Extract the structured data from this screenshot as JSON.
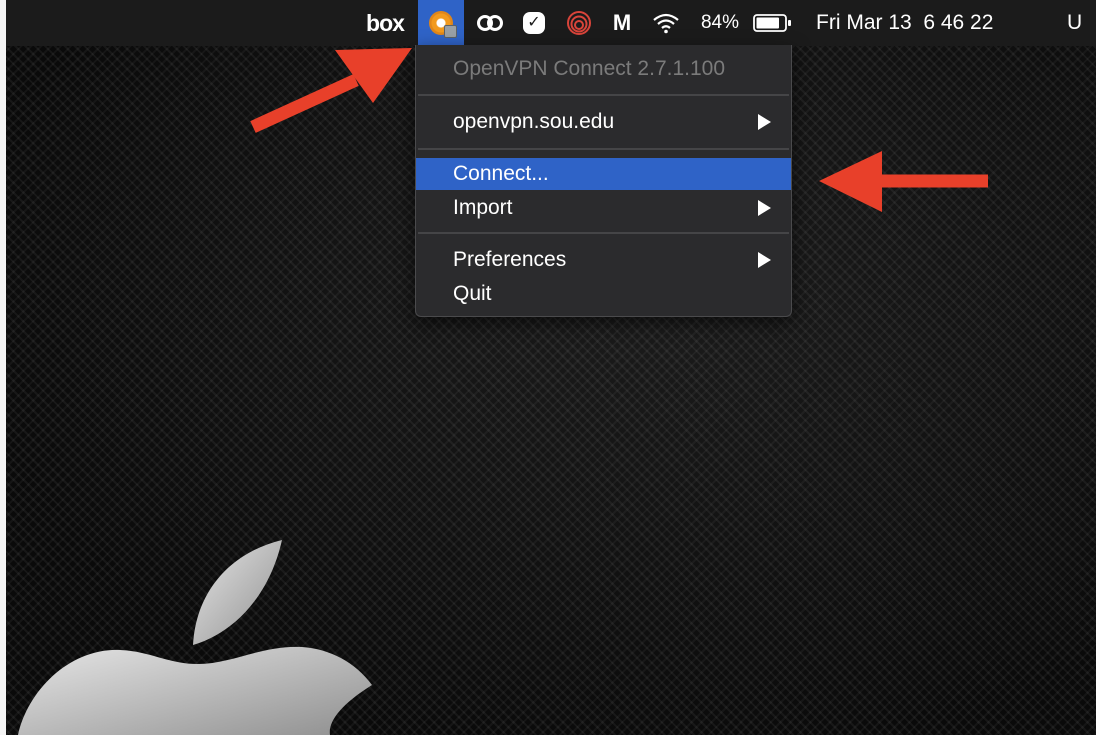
{
  "menubar": {
    "box_label": "box",
    "icons": [
      "openvpn-icon",
      "creative-cloud-icon",
      "check-shield-icon",
      "rings-icon",
      "malwarebytes-icon",
      "wifi-icon",
      "battery-icon"
    ],
    "active_icon": "openvpn-icon",
    "m_label": "M",
    "check_glyph": "✓",
    "battery_percent": "84%",
    "datetime": "Fri Mar 13  6 46 22",
    "user_initial": "U",
    "colors": {
      "bar": "#1b1b1b",
      "highlight": "#2f63c7"
    }
  },
  "menu": {
    "version": "OpenVPN Connect 2.7.1.100",
    "profile": "openvpn.sou.edu",
    "connect": "Connect...",
    "import": "Import",
    "preferences": "Preferences",
    "quit": "Quit",
    "highlighted_item": "Connect...",
    "submenu_items": [
      "openvpn.sou.edu",
      "Import",
      "Preferences"
    ]
  },
  "annotations": {
    "arrow_color": "#e8402a",
    "arrows": [
      "arrow-to-openvpn-icon",
      "arrow-to-connect-item"
    ]
  },
  "desktop": {
    "wallpaper": "carbon-fiber with apple-logo",
    "logo_color": "#bdbdbd"
  }
}
